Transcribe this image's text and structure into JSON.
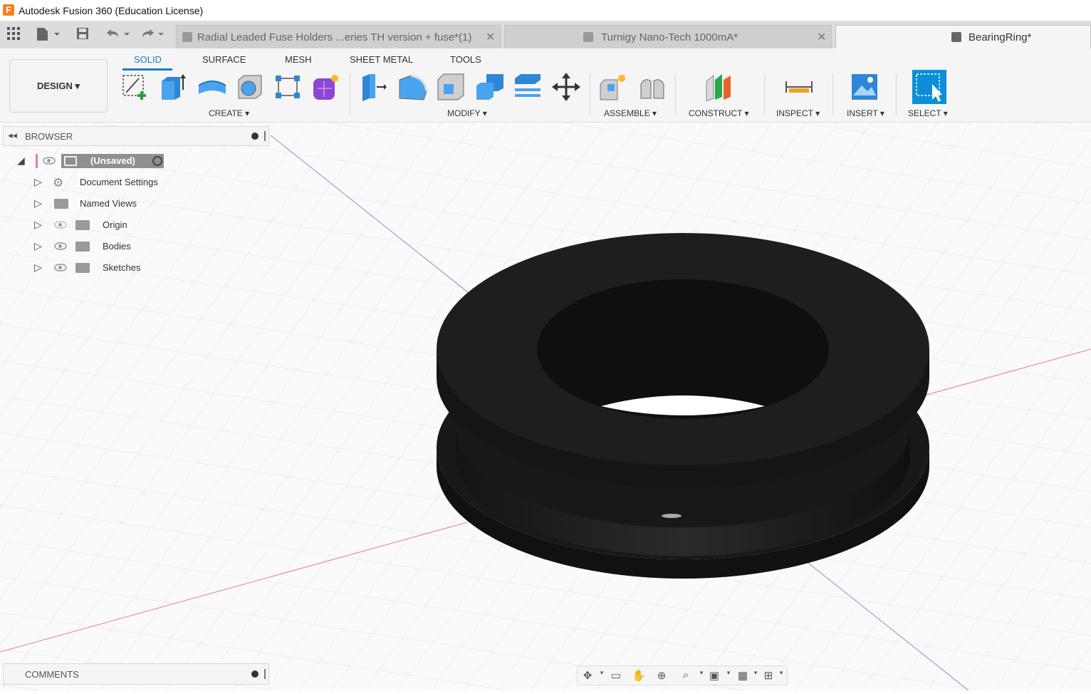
{
  "window": {
    "title": "Autodesk Fusion 360 (Education License)",
    "app_icon_letter": "F"
  },
  "tabs": [
    {
      "label": "Radial Leaded Fuse Holders ...eries TH version + fuse*(1)",
      "close": "✕"
    },
    {
      "label": "Turnigy Nano-Tech 1000mA*",
      "close": "✕"
    },
    {
      "label": "BearingRing*"
    }
  ],
  "ribbon": {
    "tabs": [
      "SOLID",
      "SURFACE",
      "MESH",
      "SHEET METAL",
      "TOOLS"
    ],
    "active_tab": "SOLID",
    "workspace": "DESIGN ▾",
    "groups": [
      "CREATE ▾",
      "MODIFY ▾",
      "ASSEMBLE ▾",
      "CONSTRUCT ▾",
      "INSPECT ▾",
      "INSERT ▾",
      "SELECT ▾"
    ]
  },
  "browser": {
    "title": "BROWSER",
    "root": "(Unsaved)",
    "items": [
      {
        "label": "Document Settings",
        "icon": "gear-icon"
      },
      {
        "label": "Named Views",
        "icon": "folder-icon"
      },
      {
        "label": "Origin",
        "icon": "folder-icon",
        "visibility": "hidden"
      },
      {
        "label": "Bodies",
        "icon": "folder-icon",
        "visibility": "visible"
      },
      {
        "label": "Sketches",
        "icon": "folder-icon",
        "visibility": "visible"
      }
    ]
  },
  "comments": {
    "title": "COMMENTS"
  },
  "colors": {
    "accent": "#1a7fc1",
    "body": "#1c1c1c",
    "grid": "#e3e3e3",
    "x_axis": "#e88080",
    "y_axis": "#8a8ae0"
  }
}
